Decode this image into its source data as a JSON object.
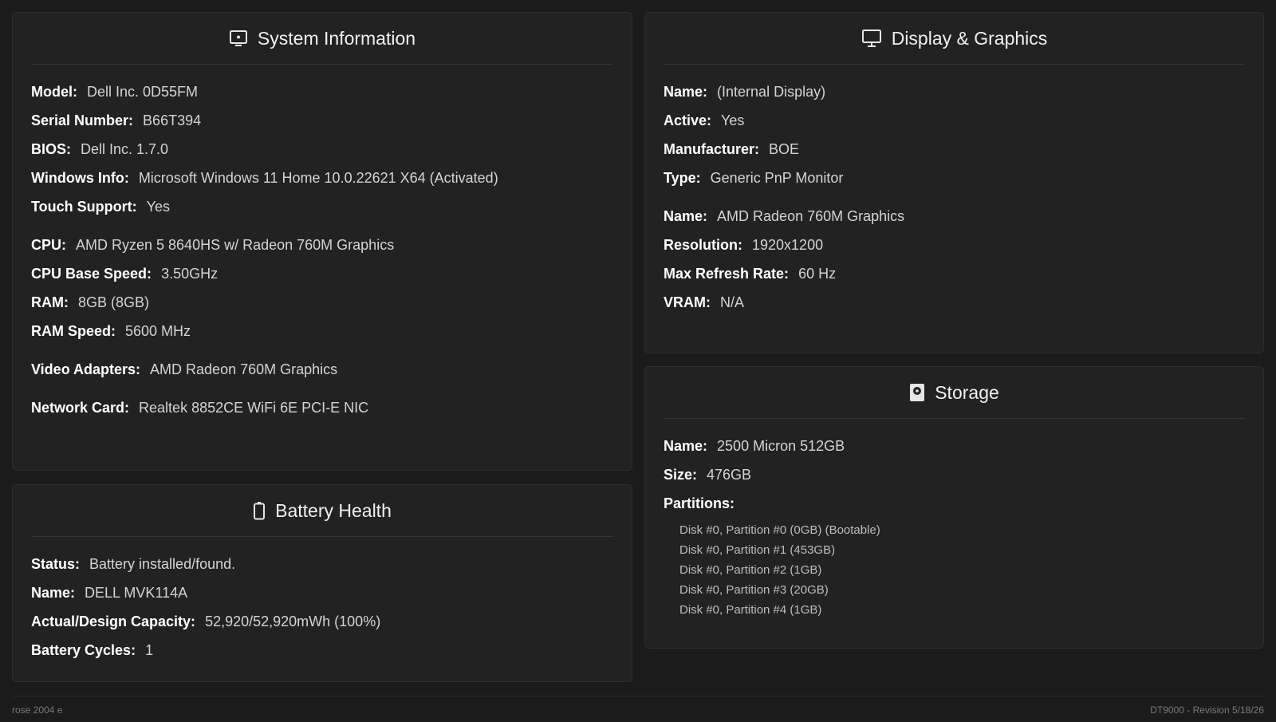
{
  "system": {
    "title": "System Information",
    "icon": "computer-icon",
    "rows": [
      {
        "label": "Model:",
        "value": "Dell Inc. 0D55FM"
      },
      {
        "label": "Serial Number:",
        "value": "B66T394"
      },
      {
        "label": "BIOS:",
        "value": "Dell Inc. 1.7.0"
      },
      {
        "label": "Windows Info:",
        "value": "Microsoft Windows 11 Home 10.0.22621 X64 (Activated)"
      },
      {
        "label": "Touch Support:",
        "value": "Yes"
      },
      {
        "label": "CPU:",
        "value": "AMD Ryzen 5 8640HS w/ Radeon 760M Graphics"
      },
      {
        "label": "CPU Base Speed:",
        "value": "3.50GHz"
      },
      {
        "label": "RAM:",
        "value": "8GB (8GB)"
      },
      {
        "label": "RAM Speed:",
        "value": "5600 MHz"
      },
      {
        "label": "Video Adapters:",
        "value": "AMD Radeon 760M Graphics"
      },
      {
        "label": "Network Card:",
        "value": "Realtek 8852CE WiFi 6E PCI-E NIC"
      }
    ]
  },
  "battery": {
    "title": "Battery Health",
    "icon": "battery-icon",
    "rows": [
      {
        "label": "Status:",
        "value": "Battery installed/found."
      },
      {
        "label": "Name:",
        "value": "DELL MVK114A"
      },
      {
        "label": "Actual/Design Capacity:",
        "value": "52,920/52,920mWh (100%)"
      },
      {
        "label": "Battery Cycles:",
        "value": "1"
      }
    ]
  },
  "display": {
    "title": "Display & Graphics",
    "icon": "monitor-icon",
    "rows": [
      {
        "label": "Name:",
        "value": "(Internal Display)"
      },
      {
        "label": "Active:",
        "value": "Yes"
      },
      {
        "label": "Manufacturer:",
        "value": "BOE"
      },
      {
        "label": "Type:",
        "value": "Generic PnP Monitor"
      },
      {
        "label": "Name:",
        "value": "AMD Radeon 760M Graphics"
      },
      {
        "label": "Resolution:",
        "value": "1920x1200"
      },
      {
        "label": "Max Refresh Rate:",
        "value": "60 Hz"
      },
      {
        "label": "VRAM:",
        "value": "N/A"
      }
    ]
  },
  "storage": {
    "title": "Storage",
    "icon": "disk-icon",
    "rows": [
      {
        "label": "Name:",
        "value": "2500 Micron 512GB"
      },
      {
        "label": "Size:",
        "value": "476GB"
      }
    ],
    "partitions_label": "Partitions:",
    "partitions": [
      "Disk #0, Partition #0 (0GB) (Bootable)",
      "Disk #0, Partition #1 (453GB)",
      "Disk #0, Partition #2 (1GB)",
      "Disk #0, Partition #3 (20GB)",
      "Disk #0, Partition #4 (1GB)"
    ]
  },
  "footer": {
    "left": "rose 2004 e",
    "right": "DT9000 - Revision 5/18/26"
  },
  "colors": {
    "background": "#1b1b1b",
    "panel": "#222222",
    "label": "#ffffff",
    "value": "#d4d4d4",
    "muted": "#7a7a7a"
  }
}
